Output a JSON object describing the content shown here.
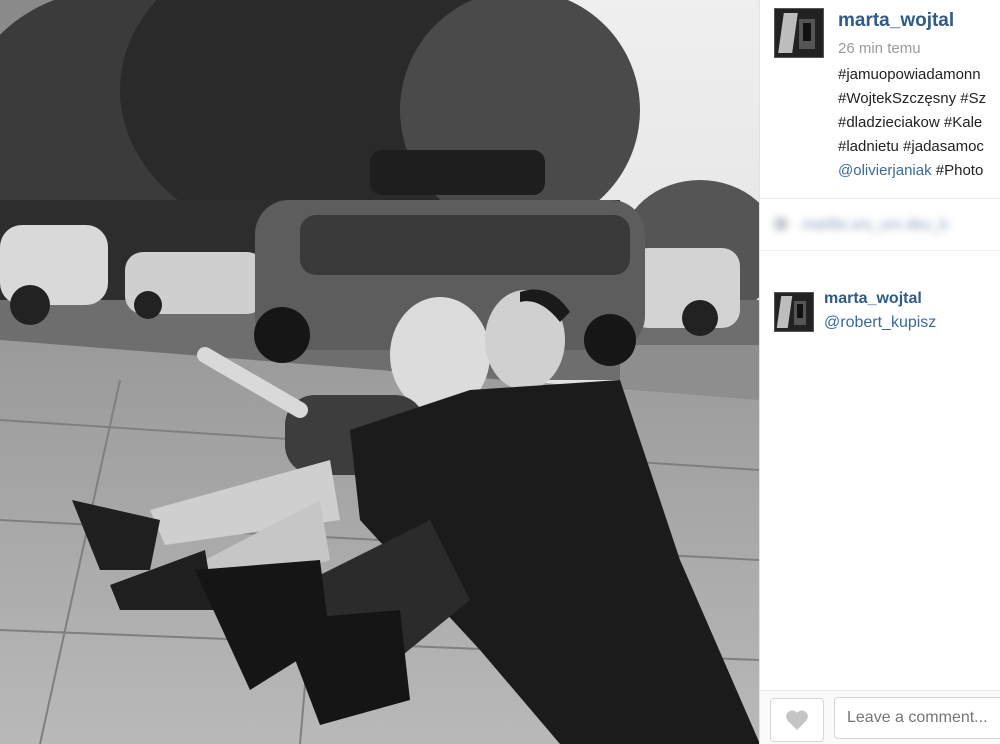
{
  "post": {
    "username": "marta_wojtal",
    "timestamp": "26 min temu",
    "caption_lines": [
      "#jamuopowiadamonn",
      "#WojtekSzczęsny #Sz",
      "#dladzieciakow #Kale",
      "#ladnietu #jadasamoc"
    ],
    "caption_mention": "@olivierjaniak",
    "caption_tail": " #Photo"
  },
  "blurred_comment": "marlila uro_uro deu_b",
  "comments": [
    {
      "username": "marta_wojtal",
      "text": "@robert_kupisz"
    }
  ],
  "comment_box": {
    "placeholder": "Leave a comment..."
  },
  "icons": {
    "like": "heart-icon"
  },
  "colors": {
    "link": "#2f5b87",
    "mention": "#3a6a98",
    "timestamp": "#9a9a9a"
  }
}
